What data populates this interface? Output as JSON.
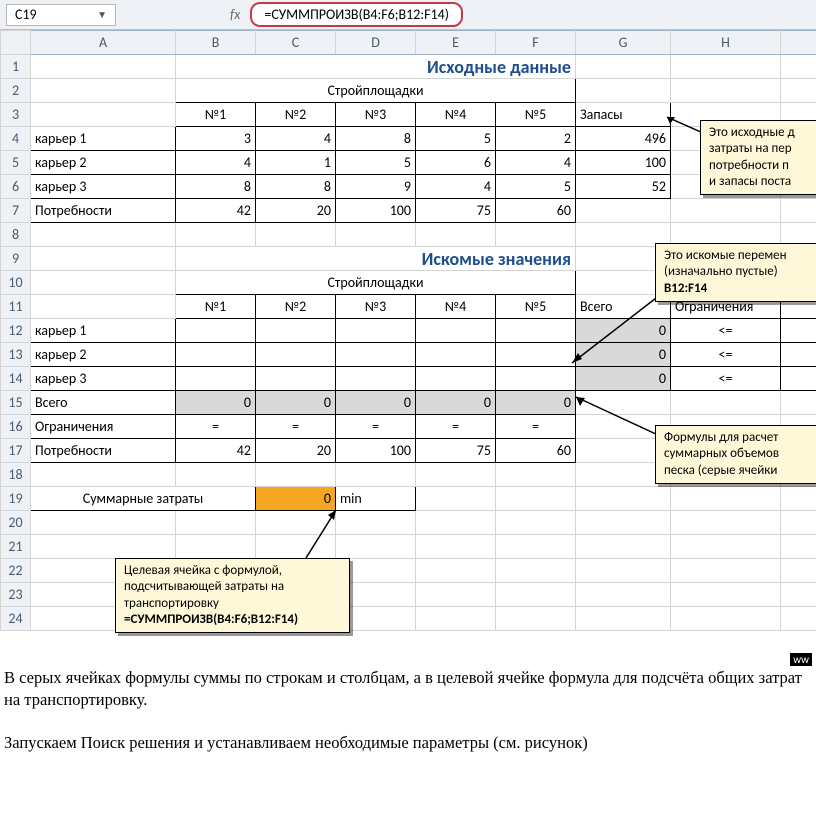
{
  "formulaBar": {
    "cellRef": "C19",
    "fxLabel": "fx",
    "formula": "=СУММПРОИЗВ(B4:F6;B12:F14)"
  },
  "columns": [
    "A",
    "B",
    "C",
    "D",
    "E",
    "F",
    "G",
    "H"
  ],
  "rows": [
    "1",
    "2",
    "3",
    "4",
    "5",
    "6",
    "7",
    "8",
    "9",
    "10",
    "11",
    "12",
    "13",
    "14",
    "15",
    "16",
    "17",
    "18",
    "19",
    "20",
    "21",
    "22",
    "23",
    "24"
  ],
  "titles": {
    "t1": "Исходные данные",
    "t2": "Искомые значения"
  },
  "labels": {
    "sites": "Стройплощадки",
    "no": [
      "№1",
      "№2",
      "№3",
      "№4",
      "№5"
    ],
    "stocks": "Запасы",
    "quarry": [
      "карьер 1",
      "карьер 2",
      "карьер 3"
    ],
    "needs": "Потребности",
    "total": "Всего",
    "constraints": "Ограничения",
    "sumCosts": "Суммарные затраты",
    "min": "min",
    "le": "<=",
    "eq": "="
  },
  "src": {
    "rows": [
      [
        3,
        4,
        8,
        5,
        2,
        496
      ],
      [
        4,
        1,
        5,
        6,
        4,
        100
      ],
      [
        8,
        8,
        9,
        4,
        5,
        52
      ]
    ],
    "needs": [
      42,
      20,
      100,
      75,
      60
    ]
  },
  "sol": {
    "totalsRow": [
      0,
      0,
      0,
      0,
      0
    ],
    "totalsCol": [
      0,
      0,
      0
    ],
    "needs": [
      42,
      20,
      100,
      75,
      60
    ],
    "cost": 0
  },
  "callouts": {
    "c1": "Это исходные д\nзатраты на пер\nпотребности п\nи запасы поста",
    "c2_a": "Это искомые перемен",
    "c2_b": "(изначально пустые)",
    "c2_c": "B12:F14",
    "c3": "Формулы для расчет\nсуммарных объемов\nпеска (серые ячейки",
    "c4_a": "Целевая ячейка с формулой,",
    "c4_b": "подсчитывающей затраты на",
    "c4_c": "транспортировку",
    "c4_d": "=СУММПРОИЗВ(B4:F6;B12:F14)"
  },
  "paragraphs": {
    "p1": "В серых ячейках формулы суммы по строкам и столбцам, а в целевой ячейке формула для подсчёта общих затрат на транспортировку.",
    "p2": "Запускаем Поиск решения и устанавливаем необходимые параметры (см. рисунок)"
  },
  "watermark": "ww"
}
